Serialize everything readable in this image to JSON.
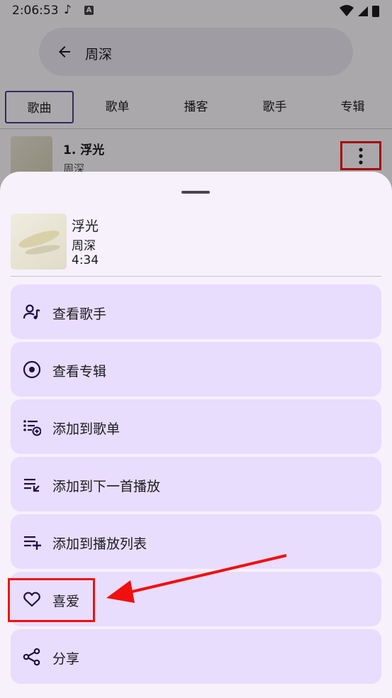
{
  "status_bar": {
    "time": "2:06:53",
    "music_icon": "music-note-icon",
    "app_icon": "a-badge-icon",
    "right_icons": [
      "wifi-icon",
      "signal-icon",
      "battery-icon"
    ]
  },
  "search": {
    "query": "周深",
    "back_icon": "arrow-left-icon"
  },
  "tabs": [
    {
      "label": "歌曲",
      "active": true
    },
    {
      "label": "歌单",
      "active": false
    },
    {
      "label": "播客",
      "active": false
    },
    {
      "label": "歌手",
      "active": false
    },
    {
      "label": "专辑",
      "active": false
    }
  ],
  "song_row": {
    "title": "1. 浮光",
    "artist": "周深",
    "more_icon": "more-vert-icon"
  },
  "sheet": {
    "title": "浮光",
    "artist": "周深",
    "duration": "4:34",
    "menu": [
      {
        "label": "查看歌手",
        "icon": "person-music-icon"
      },
      {
        "label": "查看专辑",
        "icon": "album-icon"
      },
      {
        "label": "添加到歌单",
        "icon": "playlist-add-icon"
      },
      {
        "label": "添加到下一首播放",
        "icon": "play-next-icon"
      },
      {
        "label": "添加到播放列表",
        "icon": "queue-add-icon"
      },
      {
        "label": "喜爱",
        "icon": "heart-icon"
      },
      {
        "label": "分享",
        "icon": "share-icon"
      }
    ]
  },
  "colors": {
    "menu_bg": "#e8ddfd",
    "sheet_bg": "#f6f1fa",
    "annotation_red": "#f20f0f",
    "icon": "#1f1147"
  }
}
